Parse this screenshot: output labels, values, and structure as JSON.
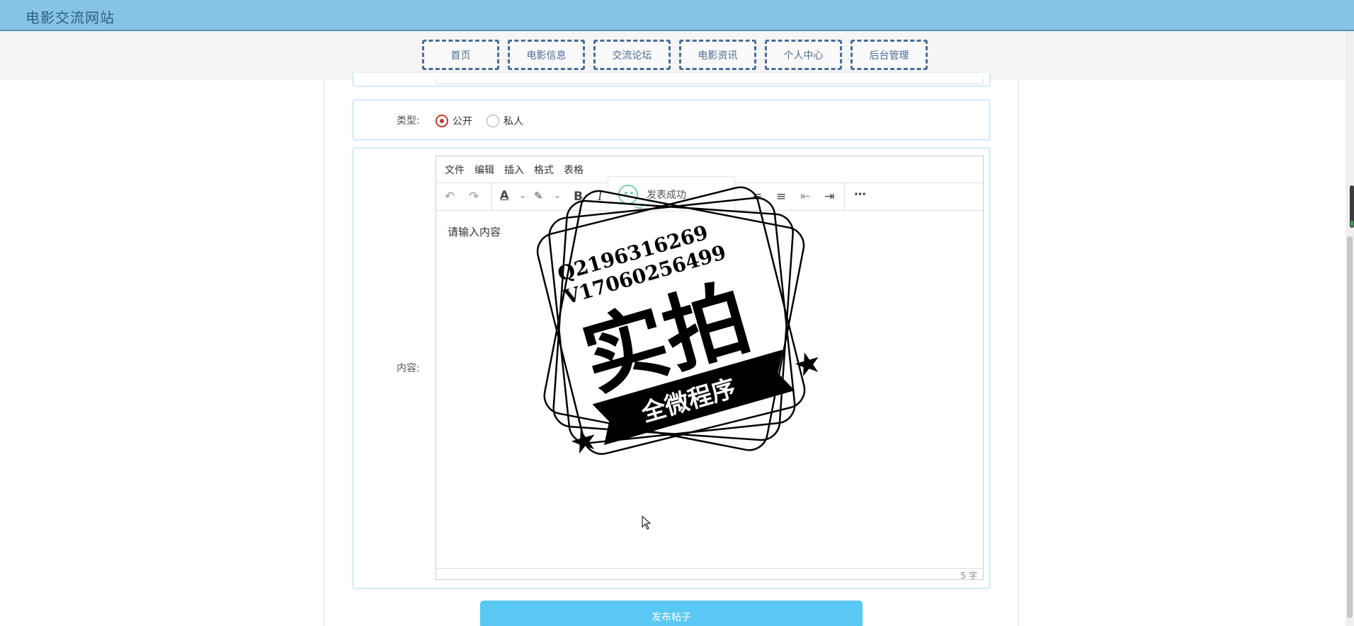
{
  "header": {
    "site_title": "电影交流网站"
  },
  "nav": {
    "items": [
      {
        "label": "首页"
      },
      {
        "label": "电影信息"
      },
      {
        "label": "交流论坛"
      },
      {
        "label": "电影资讯"
      },
      {
        "label": "个人中心"
      },
      {
        "label": "后台管理"
      }
    ]
  },
  "form": {
    "type": {
      "label": "类型:",
      "options": [
        {
          "label": "公开",
          "checked": true
        },
        {
          "label": "私人",
          "checked": false
        }
      ]
    },
    "content": {
      "label": "内容:",
      "editor": {
        "menus": [
          "文件",
          "编辑",
          "插入",
          "格式",
          "表格"
        ],
        "toolbar_icons": [
          "undo-icon",
          "redo-icon",
          "text-color-icon",
          "highlight-icon",
          "bold-icon",
          "italic-icon",
          "align-right-icon",
          "justify-icon",
          "outdent-icon",
          "indent-icon",
          "more-icon"
        ],
        "value": "请输入内容",
        "word_count": "5 字"
      }
    },
    "submit_label": "发布帖子"
  },
  "toast": {
    "text": "发表成功"
  },
  "watermark": {
    "line1": "Q2196316269",
    "line2": "V17060256499",
    "big_text": "实拍",
    "ribbon_text": "全微程序"
  },
  "colors": {
    "topbar": "#86c4e5",
    "nav_border": "#4a6d96",
    "submit": "#5ac8f5",
    "radio_checked": "#c0392b"
  }
}
